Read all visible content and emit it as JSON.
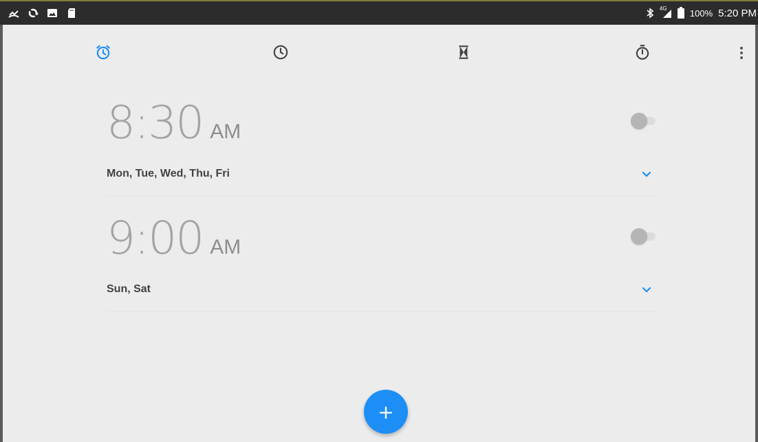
{
  "status_bar": {
    "left_icons": [
      "missed-call-icon",
      "sync-icon",
      "gallery-icon",
      "sd-card-icon"
    ],
    "bluetooth": "bluetooth-icon",
    "network": "4G",
    "battery_percent": "100%",
    "time": "5:20 PM"
  },
  "tabs": [
    {
      "name": "alarm",
      "icon": "alarm-clock-icon",
      "active": true
    },
    {
      "name": "clock",
      "icon": "clock-icon",
      "active": false
    },
    {
      "name": "timer",
      "icon": "hourglass-icon",
      "active": false
    },
    {
      "name": "stopwatch",
      "icon": "stopwatch-icon",
      "active": false
    }
  ],
  "alarms": [
    {
      "time": "8:30",
      "ampm": "AM",
      "days": "Mon, Tue, Wed, Thu, Fri",
      "enabled": false
    },
    {
      "time": "9:00",
      "ampm": "AM",
      "days": "Sun, Sat",
      "enabled": false
    }
  ],
  "fab": {
    "label": "+"
  },
  "colors": {
    "accent": "#1e8ef7",
    "background": "#ececec",
    "status_bar": "#2c2c2c",
    "time_text": "#a4a4a4",
    "days_text": "#424242"
  }
}
